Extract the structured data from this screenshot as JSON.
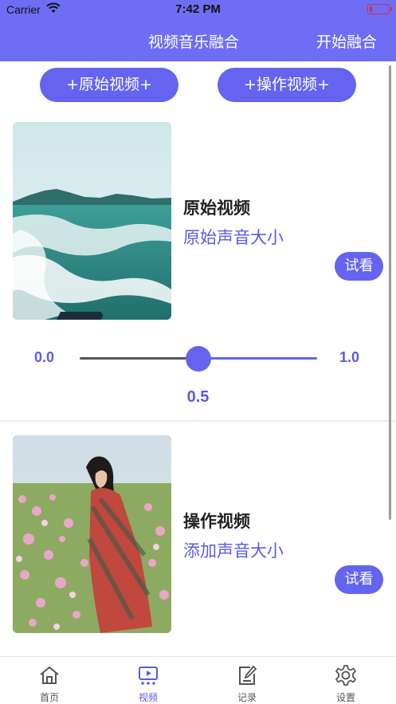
{
  "status_bar": {
    "carrier": "Carrier",
    "time": "7:42 PM"
  },
  "nav": {
    "title": "视频音乐融合",
    "start_label": "开始融合"
  },
  "buttons": {
    "add_original": "+原始视频+",
    "add_operate": "+操作视频+"
  },
  "video1": {
    "title": "原始视频",
    "subtitle": "原始声音大小",
    "try_label": "试看"
  },
  "slider": {
    "min_label": "0.0",
    "max_label": "1.0",
    "value": 0.5,
    "value_label": "0.5"
  },
  "video2": {
    "title": "操作视频",
    "subtitle": "添加声音大小",
    "try_label": "试看"
  },
  "tabs": [
    {
      "label": "首页",
      "icon": "home-icon"
    },
    {
      "label": "视频",
      "icon": "video-icon"
    },
    {
      "label": "记录",
      "icon": "edit-icon"
    },
    {
      "label": "设置",
      "icon": "gear-icon"
    }
  ],
  "colors": {
    "accent": "#6464f0",
    "nav_bg": "#6e6ef5",
    "accent_text": "#5a5aec"
  }
}
